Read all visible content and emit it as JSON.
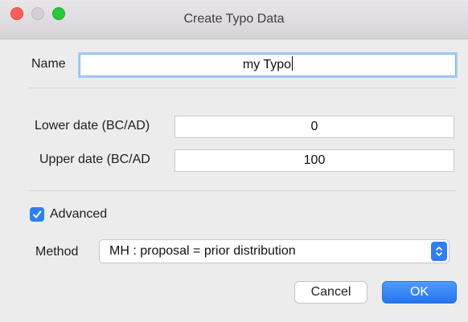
{
  "window": {
    "title": "Create Typo Data"
  },
  "name": {
    "label": "Name",
    "value": "my Typo"
  },
  "lower_date": {
    "label": "Lower date (BC/AD)",
    "value": "0"
  },
  "upper_date": {
    "label": "Upper date (BC/AD",
    "value": "100"
  },
  "advanced": {
    "label": "Advanced",
    "checked": true
  },
  "method": {
    "label": "Method",
    "selected": "MH : proposal = prior distribution"
  },
  "buttons": {
    "cancel": "Cancel",
    "ok": "OK"
  },
  "colors": {
    "accent": "#2f7ff0",
    "close": "#fe5f57",
    "maximize": "#2ac840"
  }
}
